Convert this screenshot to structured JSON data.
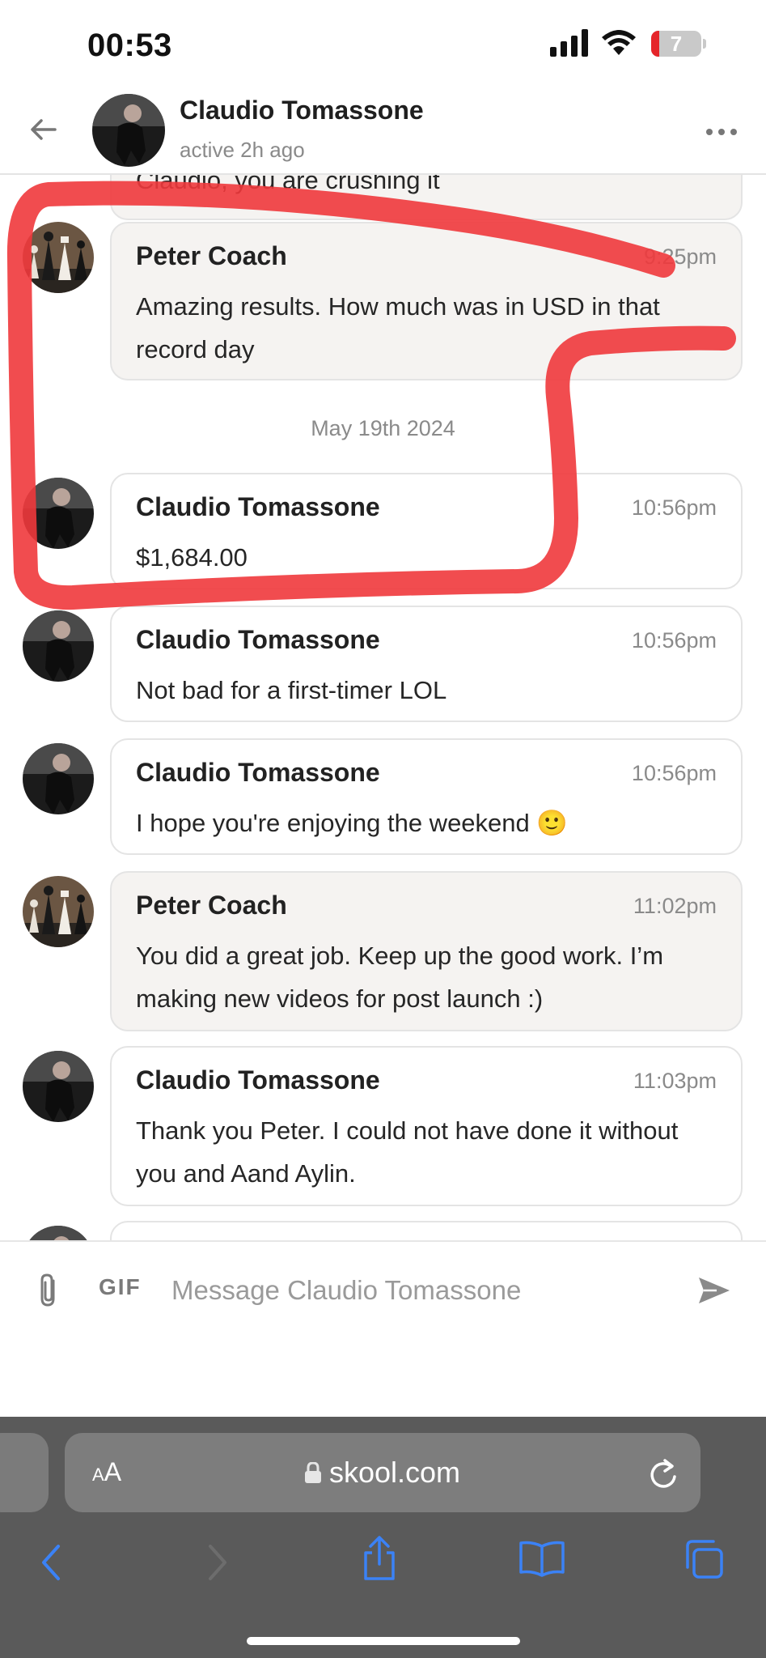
{
  "status_bar": {
    "time": "00:53",
    "battery": "7"
  },
  "header": {
    "back_icon": "arrow-left-icon",
    "name": "Claudio Tomassone",
    "status": "active 2h ago",
    "more_icon": "more-horizontal-icon"
  },
  "conversation": {
    "partial_top_text": "Claudio, you are crushing it",
    "date_separator": "May 19th 2024",
    "messages": [
      {
        "sender": "Peter Coach",
        "time": "9:25pm",
        "text": "Amazing results. How much was in USD in that record day"
      },
      {
        "sender": "Claudio Tomassone",
        "time": "10:56pm",
        "text": "$1,684.00"
      },
      {
        "sender": "Claudio Tomassone",
        "time": "10:56pm",
        "text": "Not bad for a first-timer LOL"
      },
      {
        "sender": "Claudio Tomassone",
        "time": "10:56pm",
        "text": "I hope you're enjoying the weekend 🙂"
      },
      {
        "sender": "Peter Coach",
        "time": "11:02pm",
        "text": "You did a great job. Keep up the good work. I’m making new videos for post launch :)"
      },
      {
        "sender": "Claudio Tomassone",
        "time": "11:03pm",
        "text": "Thank you Peter. I could not have done it without you and Aand Aylin."
      }
    ]
  },
  "composer": {
    "attach_icon": "paperclip-icon",
    "gif_label": "GIF",
    "placeholder": "Message Claudio Tomassone",
    "send_icon": "send-icon"
  },
  "browser": {
    "text_size_label": "AA",
    "url": "skool.com",
    "reload_icon": "reload-icon",
    "nav_icons": [
      "back-icon",
      "forward-icon",
      "share-icon",
      "bookmarks-icon",
      "tabs-icon"
    ]
  },
  "colors": {
    "bubble_border": "#e4e4e4",
    "bubble_shaded": "#f5f3f1",
    "muted_text": "#8a8a8a",
    "browser_chrome": "#5a5a5a",
    "nav_blue": "#3b82f6",
    "annotation_red": "#f0393c"
  }
}
